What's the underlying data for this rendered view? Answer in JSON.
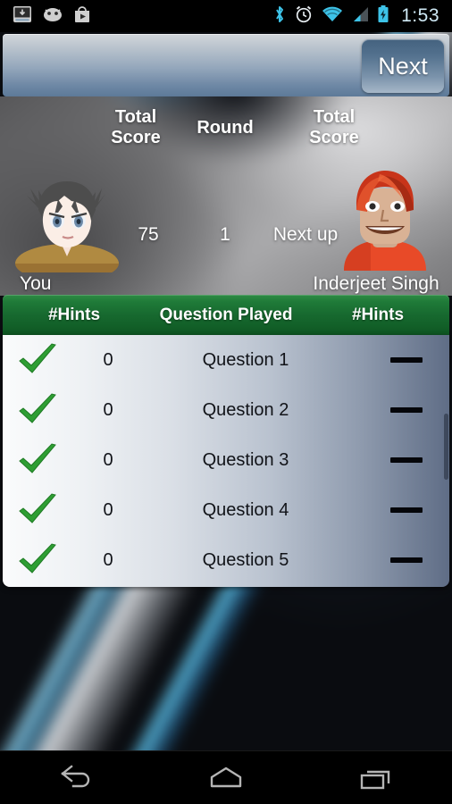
{
  "status_bar": {
    "time": "1:53",
    "left_icons": [
      {
        "name": "screenshot-icon",
        "label": "Screenshot"
      },
      {
        "name": "android-head-icon",
        "label": "Android"
      },
      {
        "name": "play-store-icon",
        "label": "Play Store"
      }
    ],
    "right_icons": [
      {
        "name": "bluetooth-icon",
        "label": "Bluetooth",
        "color": "#3dc3e8"
      },
      {
        "name": "alarm-clock-icon",
        "label": "Alarm",
        "color": "#e8eef2"
      },
      {
        "name": "wifi-icon",
        "label": "Wi-Fi",
        "color": "#3dc3e8"
      },
      {
        "name": "signal-bars-icon",
        "label": "Signal",
        "color": "#3dc3e8"
      },
      {
        "name": "battery-charging-icon",
        "label": "Battery charging",
        "color": "#3dc3e8"
      }
    ]
  },
  "top_bar": {
    "next_label": "Next"
  },
  "scoreboard": {
    "labels": {
      "total_score_left_line1": "Total",
      "total_score_left_line2": "Score",
      "round": "Round",
      "total_score_right_line1": "Total",
      "total_score_right_line2": "Score"
    },
    "values": {
      "score_left": "75",
      "round": "1",
      "score_right": "Next up"
    },
    "players": [
      {
        "name": "You",
        "side": "left"
      },
      {
        "name": "Inderjeet Singh",
        "side": "right"
      }
    ]
  },
  "table": {
    "headers": {
      "hints_left": "#Hints",
      "question_played": "Question Played",
      "hints_right": "#Hints"
    },
    "header_color": "#17692f",
    "rows": [
      {
        "status": "check",
        "hints_left": "0",
        "question": "Question 1",
        "hints_right": "—"
      },
      {
        "status": "check",
        "hints_left": "0",
        "question": "Question 2",
        "hints_right": "—"
      },
      {
        "status": "check",
        "hints_left": "0",
        "question": "Question 3",
        "hints_right": "—"
      },
      {
        "status": "check",
        "hints_left": "0",
        "question": "Question 4",
        "hints_right": "—"
      },
      {
        "status": "check",
        "hints_left": "0",
        "question": "Question 5",
        "hints_right": "—"
      }
    ],
    "check_color": "#2e9e33"
  },
  "nav_bar": {
    "buttons": [
      {
        "name": "back-button",
        "label": "Back"
      },
      {
        "name": "home-button",
        "label": "Home"
      },
      {
        "name": "recents-button",
        "label": "Recent apps"
      }
    ]
  }
}
